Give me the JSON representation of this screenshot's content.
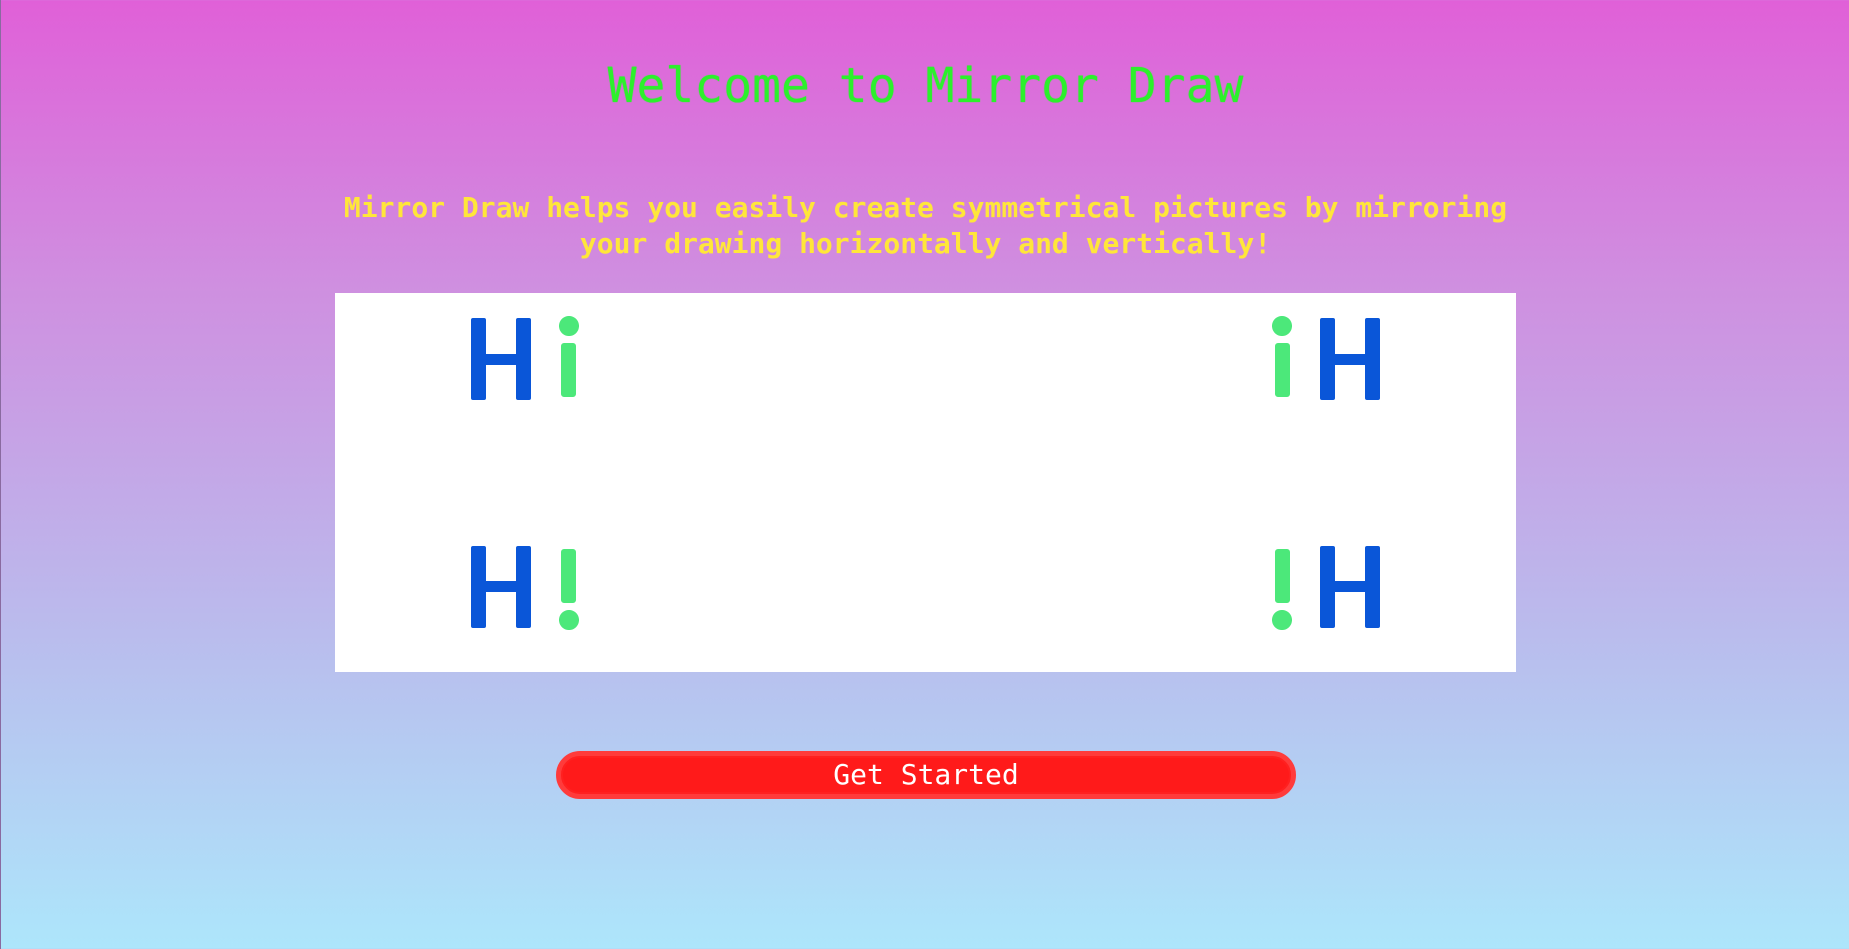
{
  "page": {
    "title": "Welcome to Mirror Draw",
    "tagline": "Mirror Draw helps you easily create symmetrical pictures by mirroring your drawing horizontally and vertically!",
    "cta_label": "Get Started"
  },
  "colors": {
    "title": "#2cf02c",
    "tagline": "#ffe63a",
    "button": "#ff1a1a",
    "letter_h": "#0a56d8",
    "letter_i": "#4ce87a"
  }
}
